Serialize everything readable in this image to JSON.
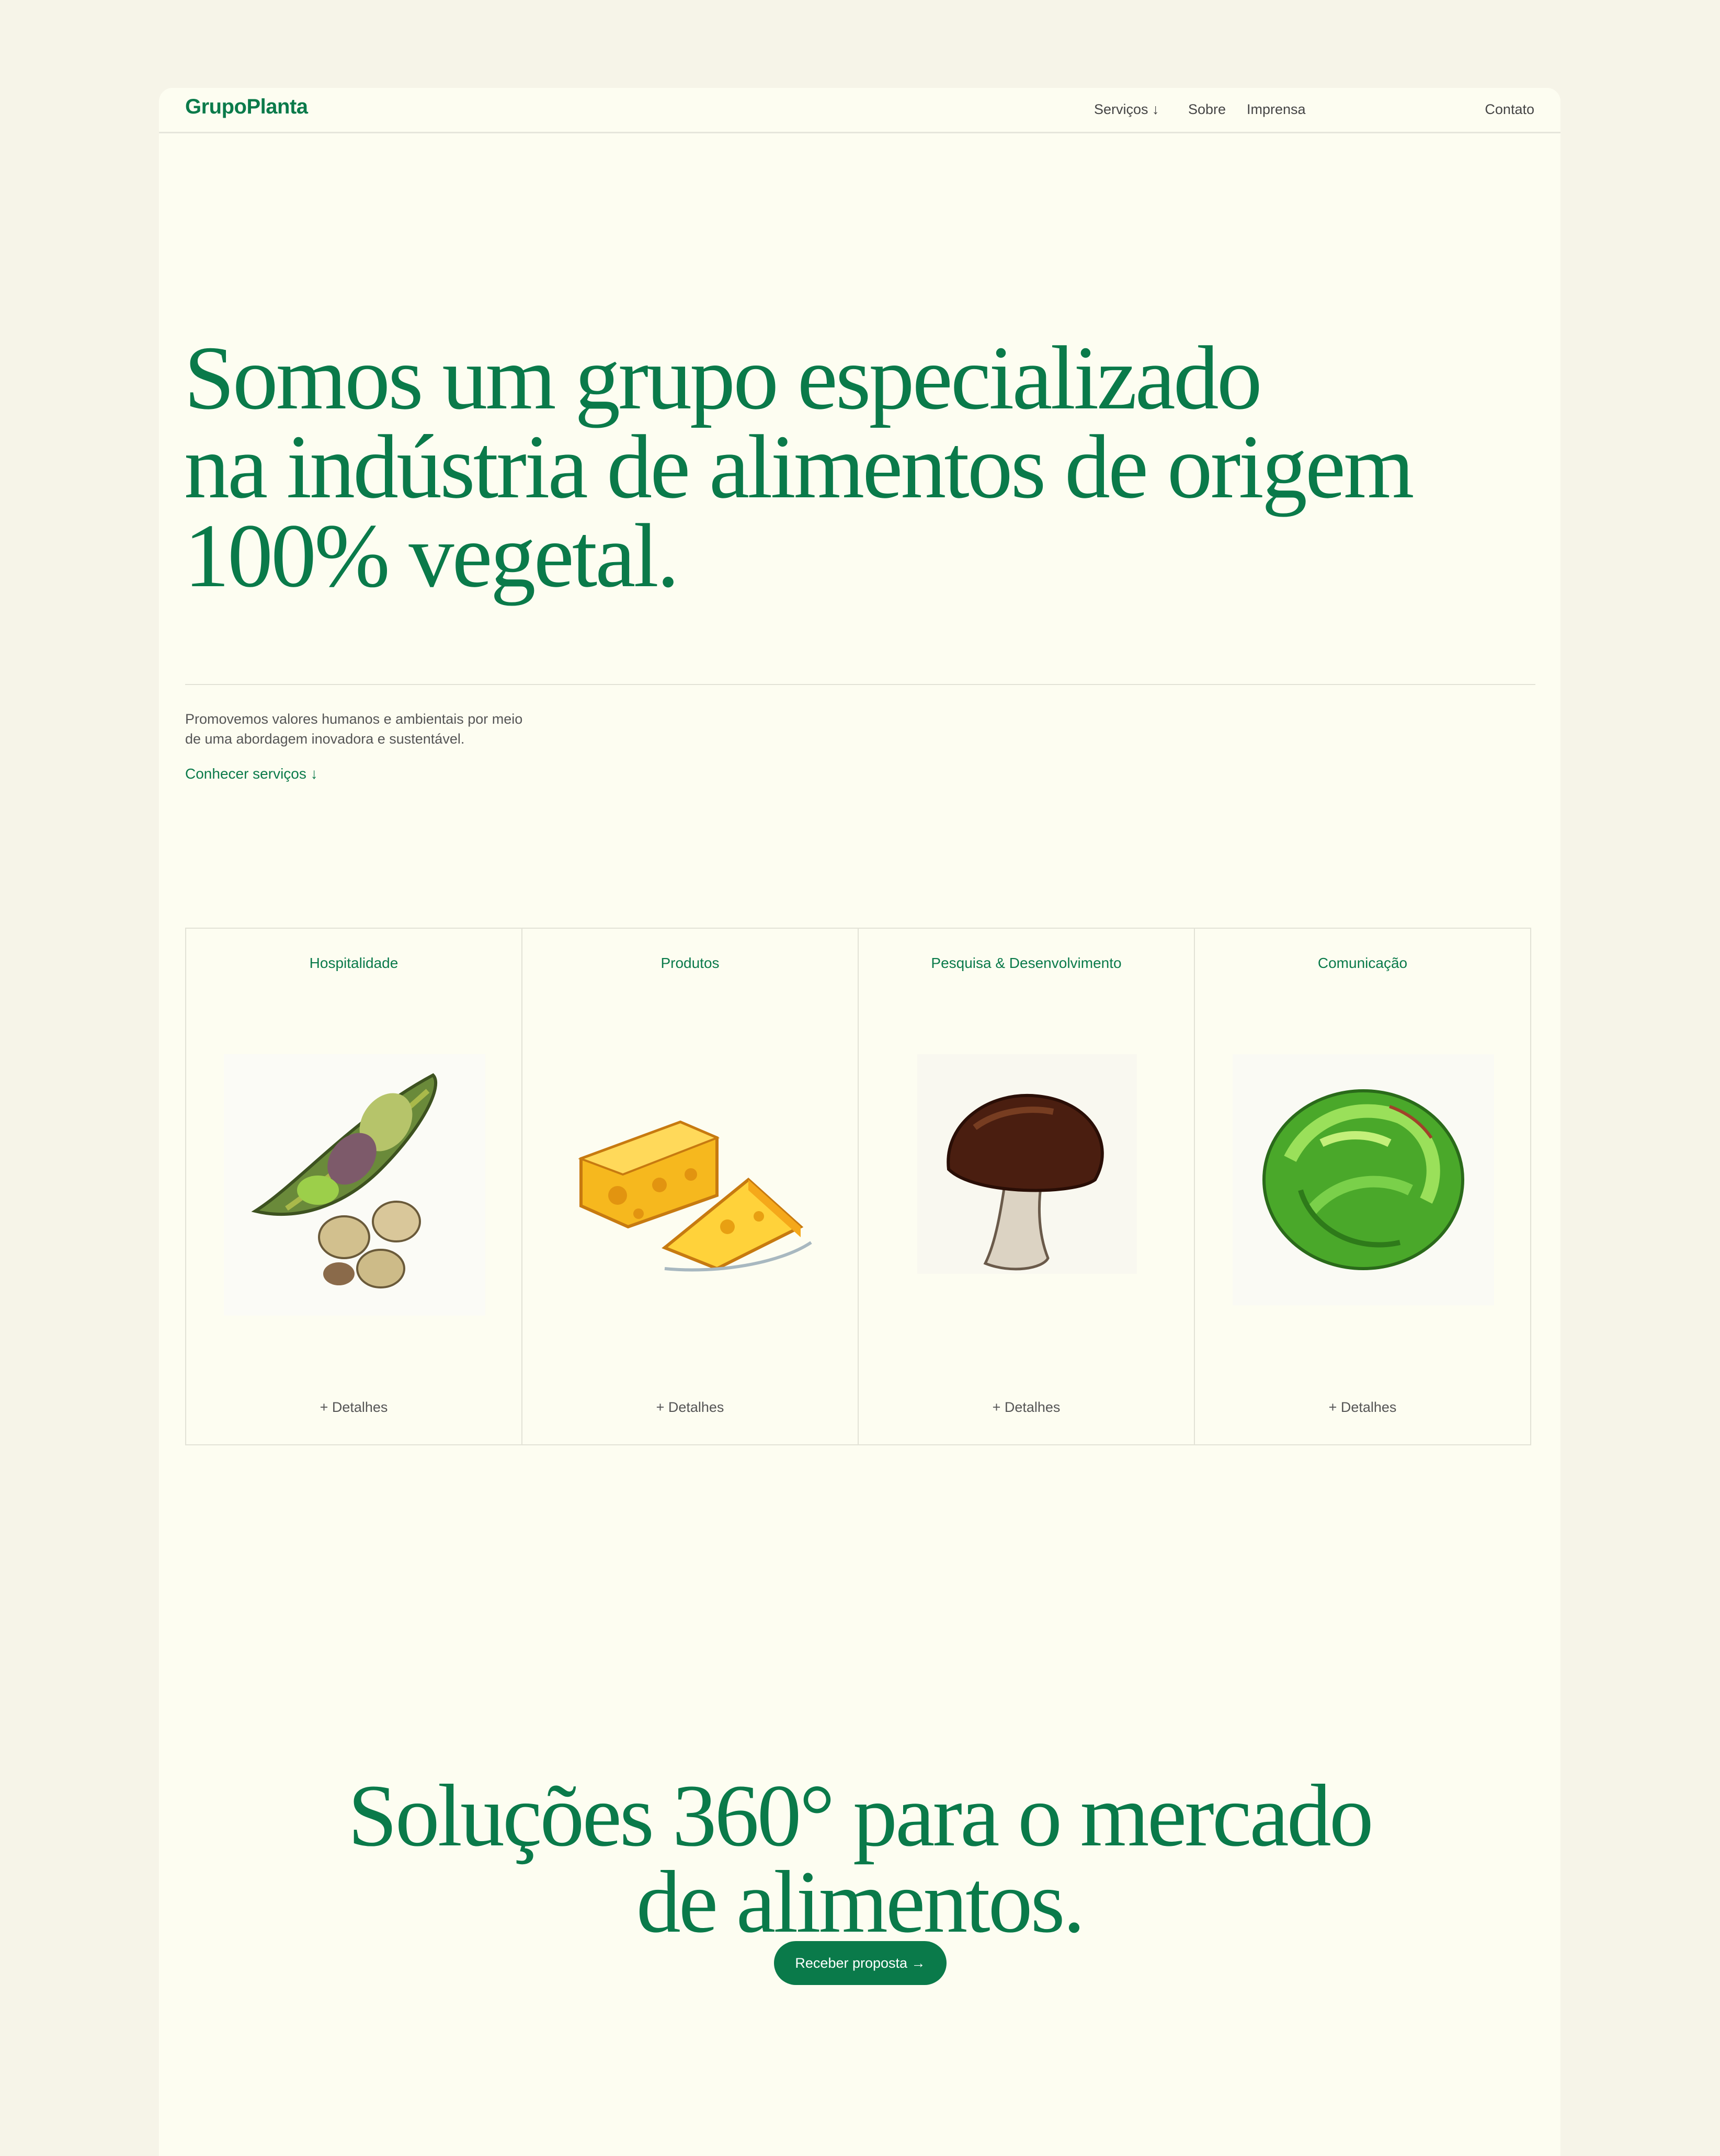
{
  "nav": {
    "logo": "GrupoPlanta",
    "services": "Serviços ↓",
    "about": "Sobre",
    "press": "Imprensa",
    "contact": "Contato"
  },
  "hero": {
    "line1": "Somos um grupo especializado",
    "line2": "na indústria de alimentos de origem",
    "line3": "100% vegetal.",
    "intro_line1": "Promovemos valores humanos e ambientais por meio",
    "intro_line2": "de uma abordagem inovadora e sustentável.",
    "link": "Conhecer serviços ↓"
  },
  "cards": [
    {
      "title": "Hospitalidade",
      "link": "+ Detalhes",
      "icon": "bean-pod-icon"
    },
    {
      "title": "Produtos",
      "link": "+ Detalhes",
      "icon": "cheese-icon"
    },
    {
      "title": "Pesquisa & Desenvolvimento",
      "link": "+ Detalhes",
      "icon": "mushroom-icon"
    },
    {
      "title": "Comunicação",
      "link": "+ Detalhes",
      "icon": "lettuce-icon"
    }
  ],
  "solutions": {
    "line1": "Soluções 360° para o mercado",
    "line2": "de alimentos.",
    "cta": "Receber proposta →"
  },
  "colors": {
    "brand": "#0a7a4a",
    "background": "#f6f4e8",
    "panel": "#fdfdf1"
  }
}
